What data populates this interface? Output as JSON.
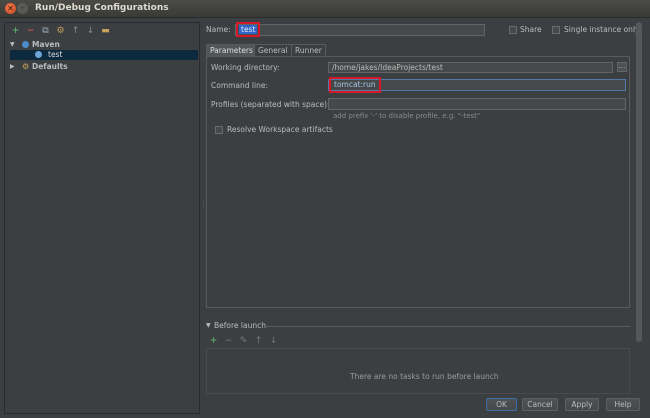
{
  "window": {
    "title": "Run/Debug Configurations",
    "close_icon": "✕",
    "minimize_icon": "–"
  },
  "left_toolbar": {
    "add": "+",
    "remove": "−",
    "copy": "⧉",
    "settings": "⚙",
    "up": "↑",
    "down": "↓",
    "folder": "▬"
  },
  "tree": {
    "maven": {
      "arrow": "▼",
      "label": "Maven"
    },
    "test": {
      "label": "test"
    },
    "defaults": {
      "arrow": "▶",
      "label": "Defaults"
    }
  },
  "name_row": {
    "label": "Name:",
    "value": "test",
    "share_label": "Share",
    "single_instance_label": "Single instance only",
    "share_checked": false,
    "single_instance_checked": false
  },
  "tabs": {
    "parameters": "Parameters",
    "general": "General",
    "runner": "Runner"
  },
  "params": {
    "working_dir_label": "Working directory:",
    "working_dir_value": "/home/jakes/IdeaProjects/test",
    "browse_label": "...",
    "command_line_label": "Command line:",
    "command_line_value": "tomcat:run",
    "profiles_label": "Profiles (separated with space):",
    "profiles_value": "",
    "profiles_hint": "add prefix '-' to disable profile, e.g. \"-test\"",
    "resolve_label": "Resolve Workspace artifacts",
    "resolve_checked": false
  },
  "before_launch": {
    "arrow": "▼",
    "title": "Before launch",
    "empty_text": "There are no tasks to run before launch",
    "add": "+",
    "remove": "−",
    "edit": "✎",
    "up": "↑",
    "down": "↓"
  },
  "buttons": {
    "ok": "OK",
    "cancel": "Cancel",
    "apply": "Apply",
    "help": "Help"
  },
  "colors": {
    "background": "#3c3f41",
    "selection": "#0d293e",
    "highlight_box": "#d5182a",
    "add_green": "#59a869",
    "remove_red": "#c75450"
  }
}
